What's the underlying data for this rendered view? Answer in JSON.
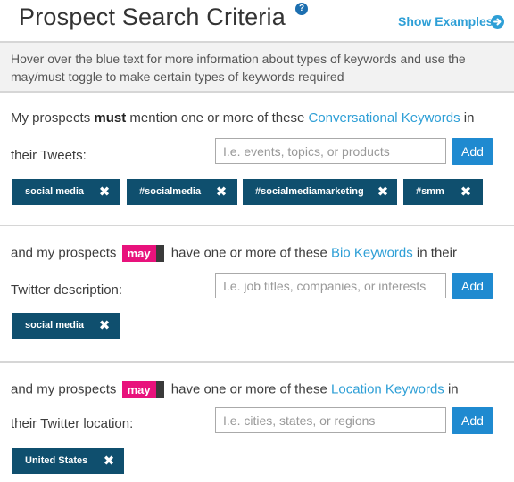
{
  "header": {
    "title": "Prospect Search Criteria",
    "help_glyph": "?",
    "show_examples": "Show Examples"
  },
  "intro": {
    "text": "Hover over the blue text for more information about types of keywords and use the may/must toggle to make certain types of keywords required"
  },
  "conversational": {
    "pre": "My prospects ",
    "requirement": "must",
    "mid": " mention one or more of these ",
    "link": "Conversational Keywords",
    "post": " in",
    "line2": "their Tweets:",
    "placeholder": "I.e. events, topics, or products",
    "add_label": "Add",
    "tags": [
      "social media",
      "#socialmedia",
      "#socialmediamarketing",
      "#smm"
    ]
  },
  "bio": {
    "pre": "and my prospects",
    "toggle": "may",
    "mid": "have one or more of these ",
    "link": "Bio Keywords",
    "post": " in their",
    "line2": "Twitter description:",
    "placeholder": "I.e. job titles, companies, or interests",
    "add_label": "Add",
    "tags": [
      "social media"
    ]
  },
  "location": {
    "pre": "and my prospects",
    "toggle": "may",
    "mid": "have one or more of these ",
    "link": "Location Keywords",
    "post": " in",
    "line2": "their Twitter location:",
    "placeholder": "I.e. cities, states, or regions",
    "add_label": "Add",
    "tags": [
      "United States"
    ]
  },
  "icons": {
    "help": "question-circle-icon",
    "show_examples": "arrow-circle-right-icon",
    "tag_remove": "close-x-icon"
  },
  "tag_remove_glyph": "✖",
  "colors": {
    "accent_link": "#2e9fd6",
    "add_button": "#1f8ad0",
    "tag_bg": "#0f4f6e",
    "may_toggle": "#e8127c",
    "intro_bg": "#f2f2f2"
  }
}
